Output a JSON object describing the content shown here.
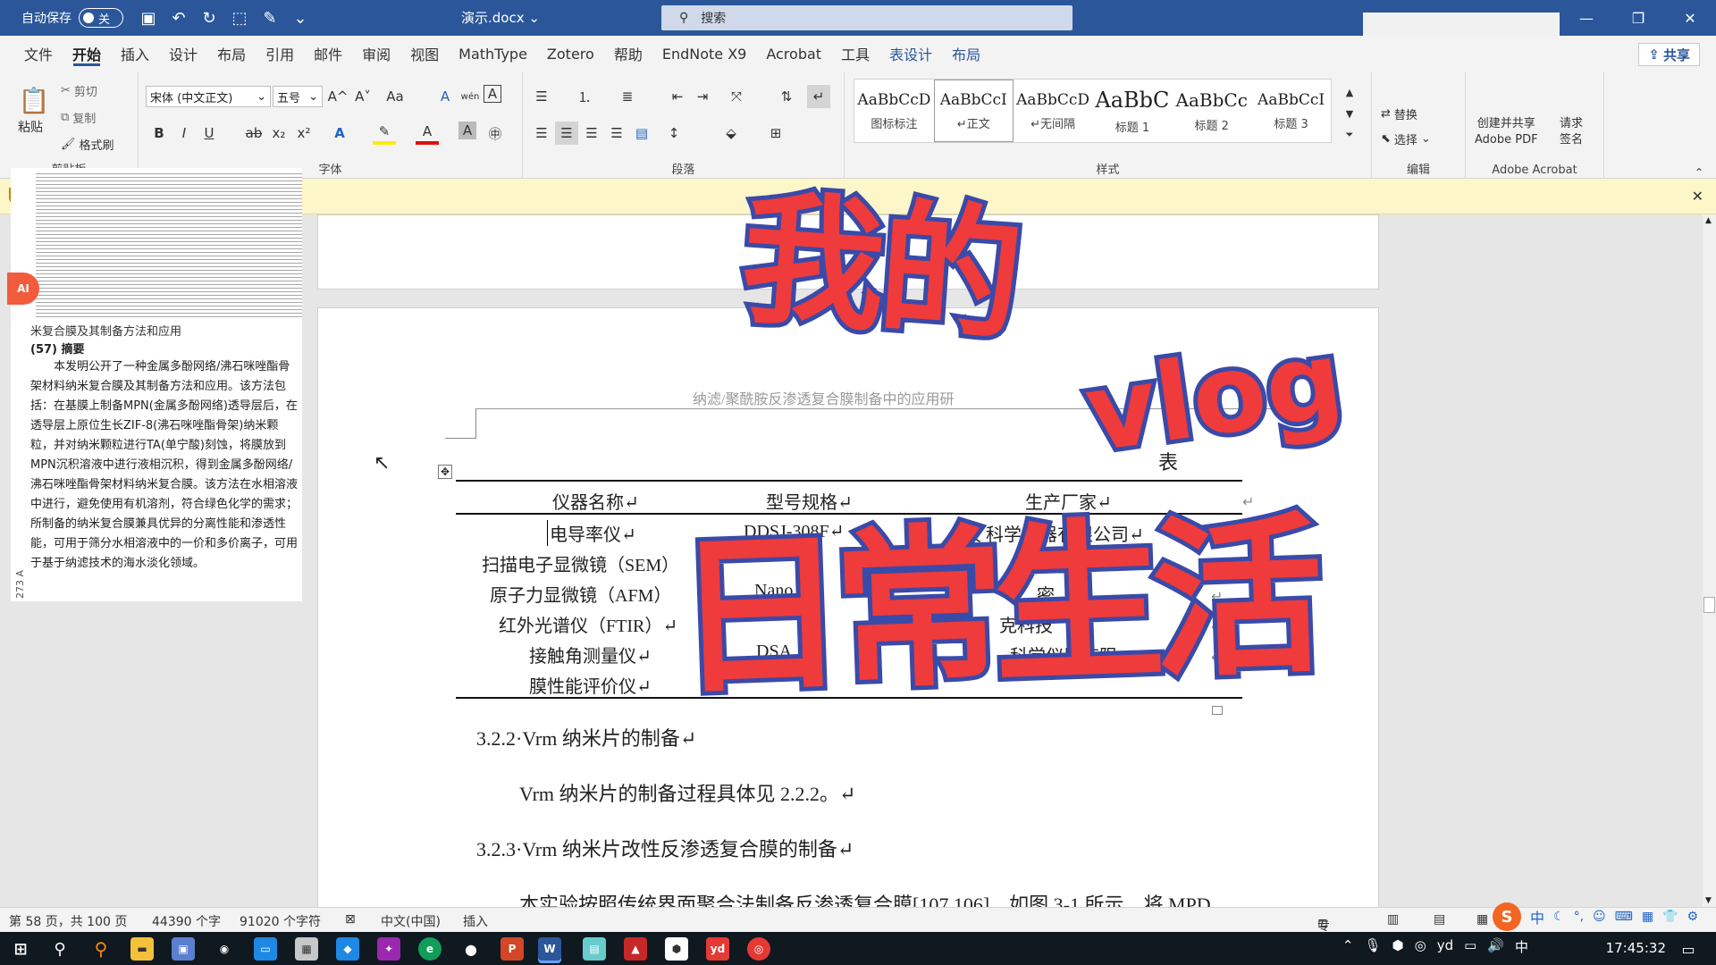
{
  "titlebar": {
    "autosave_label": "自动保存",
    "autosave_state": "关",
    "doc_title": "演示.docx",
    "doc_title_caret": "⌄",
    "search_placeholder": "搜索"
  },
  "menu": {
    "tabs": [
      "文件",
      "开始",
      "插入",
      "设计",
      "布局",
      "引用",
      "邮件",
      "审阅",
      "视图",
      "MathType",
      "Zotero",
      "帮助",
      "EndNote X9",
      "Acrobat",
      "工具",
      "表设计",
      "布局"
    ],
    "share": "共享"
  },
  "ribbon": {
    "clipboard": {
      "paste": "粘贴",
      "cut": "剪切",
      "copy": "复制",
      "format_painter": "格式刷",
      "label": "剪贴板"
    },
    "font": {
      "font_name": "宋体 (中文正文)",
      "font_size": "五号",
      "label": "字体",
      "bold": "B",
      "italic": "I",
      "underline": "U",
      "strike": "ab",
      "sub": "x₂",
      "sup": "x²",
      "grow": "A^",
      "shrink": "A˅",
      "case": "Aa",
      "clear": "A",
      "phonetic": "wén",
      "border": "A"
    },
    "paragraph": {
      "label": "段落"
    },
    "styles": {
      "label": "样式",
      "items": [
        {
          "preview": "AaBbCcD",
          "name": "图标标注"
        },
        {
          "preview": "AaBbCcI",
          "name": "↵正文"
        },
        {
          "preview": "AaBbCcD",
          "name": "↵无间隔"
        },
        {
          "preview": "AaBbC",
          "name": "标题 1"
        },
        {
          "preview": "AaBbCc",
          "name": "标题 2"
        },
        {
          "preview": "AaBbCcI",
          "name": "标题 3"
        }
      ]
    },
    "editing": {
      "replace": "替换",
      "select": "选择",
      "label": "编辑"
    },
    "acrobat": {
      "create_pdf": "创建并共享\nAdobe PDF",
      "request_sign": "请求\n签名",
      "label": "Adobe Acrobat"
    }
  },
  "document": {
    "running_head": "纳滤/聚酰胺反渗透复合膜制备中的应用研",
    "table_caption_partial": "表",
    "table": {
      "headers": [
        "仪器名称↵",
        "型号规格↵",
        "生产厂家↵"
      ],
      "rows": [
        [
          "电导率仪↵",
          "DDSJ-308F↵",
          "仪 科学仪器有限公司↵"
        ],
        [
          "扫描电子显微镜（SEM）",
          "",
          "器 公"
        ],
        [
          "原子力显微镜（AFM）",
          "Nano",
          "密"
        ],
        [
          "红外光谱仪（FTIR）↵",
          "",
          "克科技"
        ],
        [
          "接触角测量仪↵",
          "DSA",
          "科学仪器有限"
        ],
        [
          "膜性能评价仪↵",
          "",
          ""
        ]
      ]
    },
    "section_322": "3.2.2·Vrm 纳米片的制备↵",
    "para_322": "Vrm 纳米片的制备过程具体见 2.2.2。↵",
    "section_323": "3.2.3·Vrm 纳米片改性反渗透复合膜的制备↵",
    "para_323": "本实验按照传统界面聚合法制备反渗透复合膜[107,106]，如图 3-1 所示，将 MPD"
  },
  "left_panel": {
    "title": "米复合膜及其制备方法和应用",
    "abstract_label": "(57) 摘要",
    "abstract": "本发明公开了一种金属多酚网络/沸石咪唑酯骨架材料纳米复合膜及其制备方法和应用。该方法包括：在基膜上制备MPN(金属多酚网络)透导层后，在透导层上原位生长ZIF-8(沸石咪唑酯骨架)纳米颗粒，并对纳米颗粒进行TA(单宁酸)刻蚀，将膜放到MPN沉积溶液中进行液相沉积，得到金属多酚网络/沸石咪唑酯骨架材料纳米复合膜。该方法在水相溶液中进行，避免使用有机溶剂，符合绿色化学的需求；所制备的纳米复合膜兼具优异的分离性能和渗透性能，可用于筛分水相溶液中的一价和多价离子，可用于基于纳滤技术的海水淡化领域。",
    "side_text": "273 A",
    "ai_badge": "AI"
  },
  "overlay": {
    "line1": "我的",
    "line2": "vlog",
    "line3": "日常生活"
  },
  "statusbar": {
    "page": "第 58 页，共 100 页",
    "words": "44390 个字",
    "chars": "91020 个字符",
    "lang": "中文(中国)",
    "mode": "插入",
    "focus": "专注"
  },
  "taskbar": {
    "time": "17:45:32",
    "ime": "中"
  }
}
